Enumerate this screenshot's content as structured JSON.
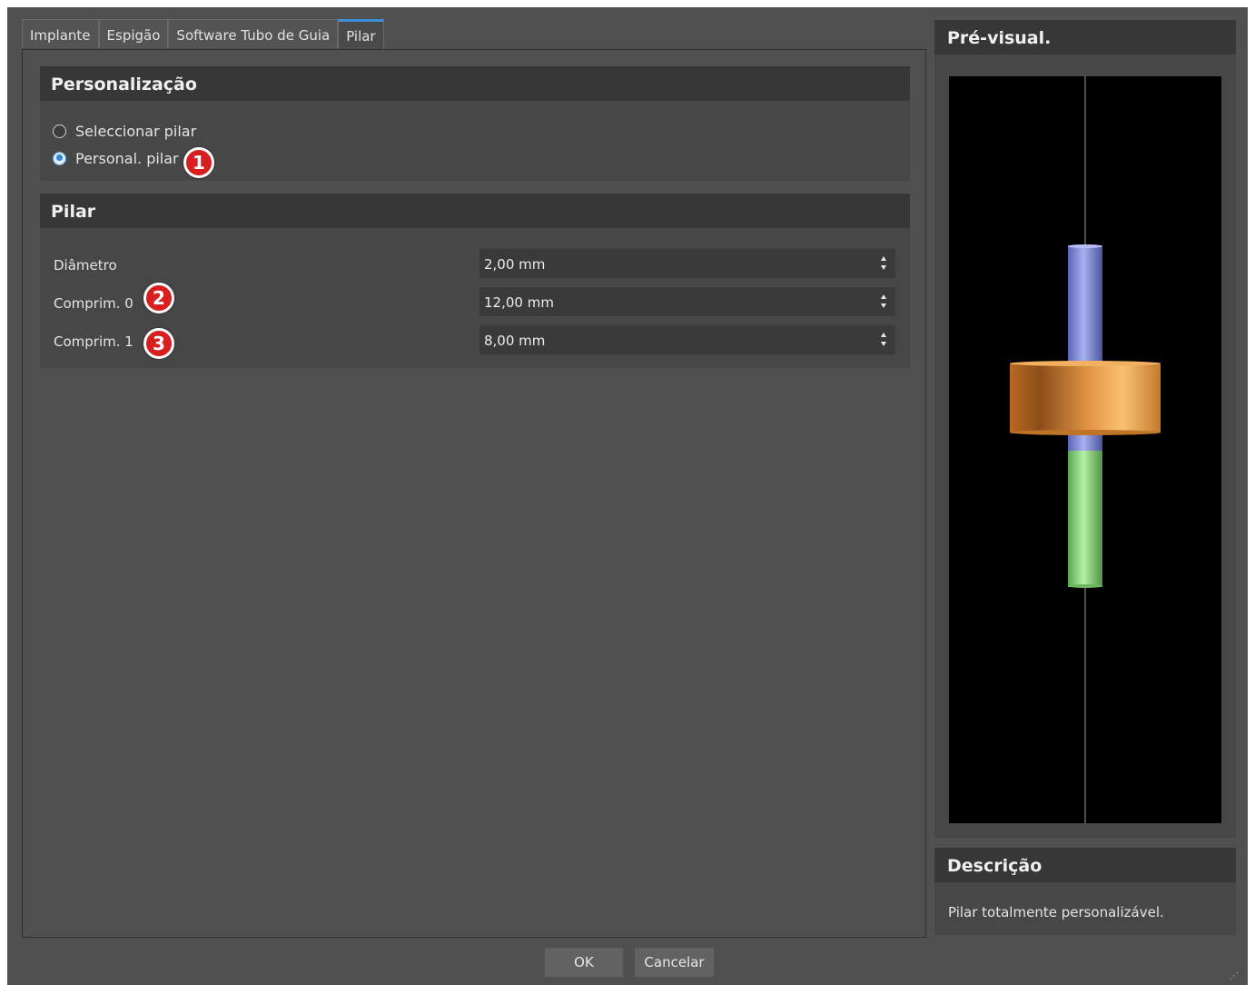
{
  "tabs": [
    {
      "label": "Implante",
      "active": false
    },
    {
      "label": "Espigão",
      "active": false
    },
    {
      "label": "Software Tubo de Guia",
      "active": false
    },
    {
      "label": "Pilar",
      "active": true
    }
  ],
  "personalization": {
    "title": "Personalização",
    "options": [
      {
        "label": "Seleccionar pilar",
        "checked": false
      },
      {
        "label": "Personal. pilar",
        "checked": true
      }
    ]
  },
  "pilar": {
    "title": "Pilar",
    "params": [
      {
        "label": "Diâmetro",
        "value": "2,00 mm"
      },
      {
        "label": "Comprim. 0",
        "value": "12,00 mm"
      },
      {
        "label": "Comprim. 1",
        "value": "8,00 mm"
      }
    ]
  },
  "markers": [
    "1",
    "2",
    "3"
  ],
  "preview": {
    "title": "Pré-visual.",
    "colors": {
      "background": "#000000",
      "upper_cylinder": "#8f96e0",
      "collar": "#e8963c",
      "lower_cylinder": "#8ed67e",
      "axis_line": "#9a9a9a"
    }
  },
  "description": {
    "title": "Descrição",
    "text": "Pilar totalmente personalizável."
  },
  "buttons": {
    "ok": "OK",
    "cancel": "Cancelar"
  },
  "colors": {
    "accent": "#3b8fd9",
    "marker": "#d81e1e"
  }
}
